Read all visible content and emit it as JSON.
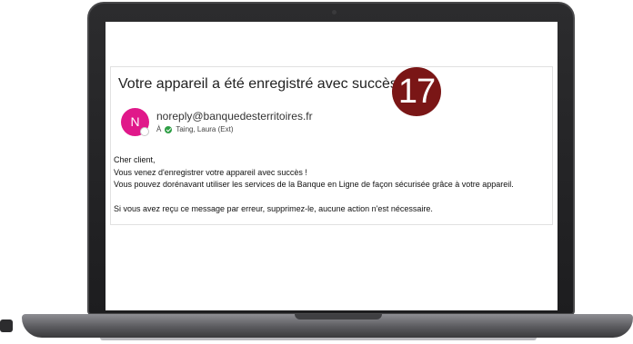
{
  "email": {
    "subject": "Votre appareil a été enregistré avec succès",
    "sender_initial": "N",
    "sender": "noreply@banquedesterritoires.fr",
    "to_label": "À",
    "recipient": "Taing, Laura (Ext)",
    "body": {
      "greeting": "Cher client,",
      "line1": "Vous venez d'enregistrer votre appareil avec succès !",
      "line2": "Vous pouvez dorénavant utiliser les services de la Banque en Ligne de façon sécurisée grâce à votre appareil.",
      "line3": "Si vous avez reçu ce message par erreur, supprimez-le, aucune action n'est nécessaire."
    }
  },
  "step_badge": "17",
  "colors": {
    "avatar": "#e0188a",
    "badge": "#7a1616",
    "verified": "#2e9e45"
  }
}
